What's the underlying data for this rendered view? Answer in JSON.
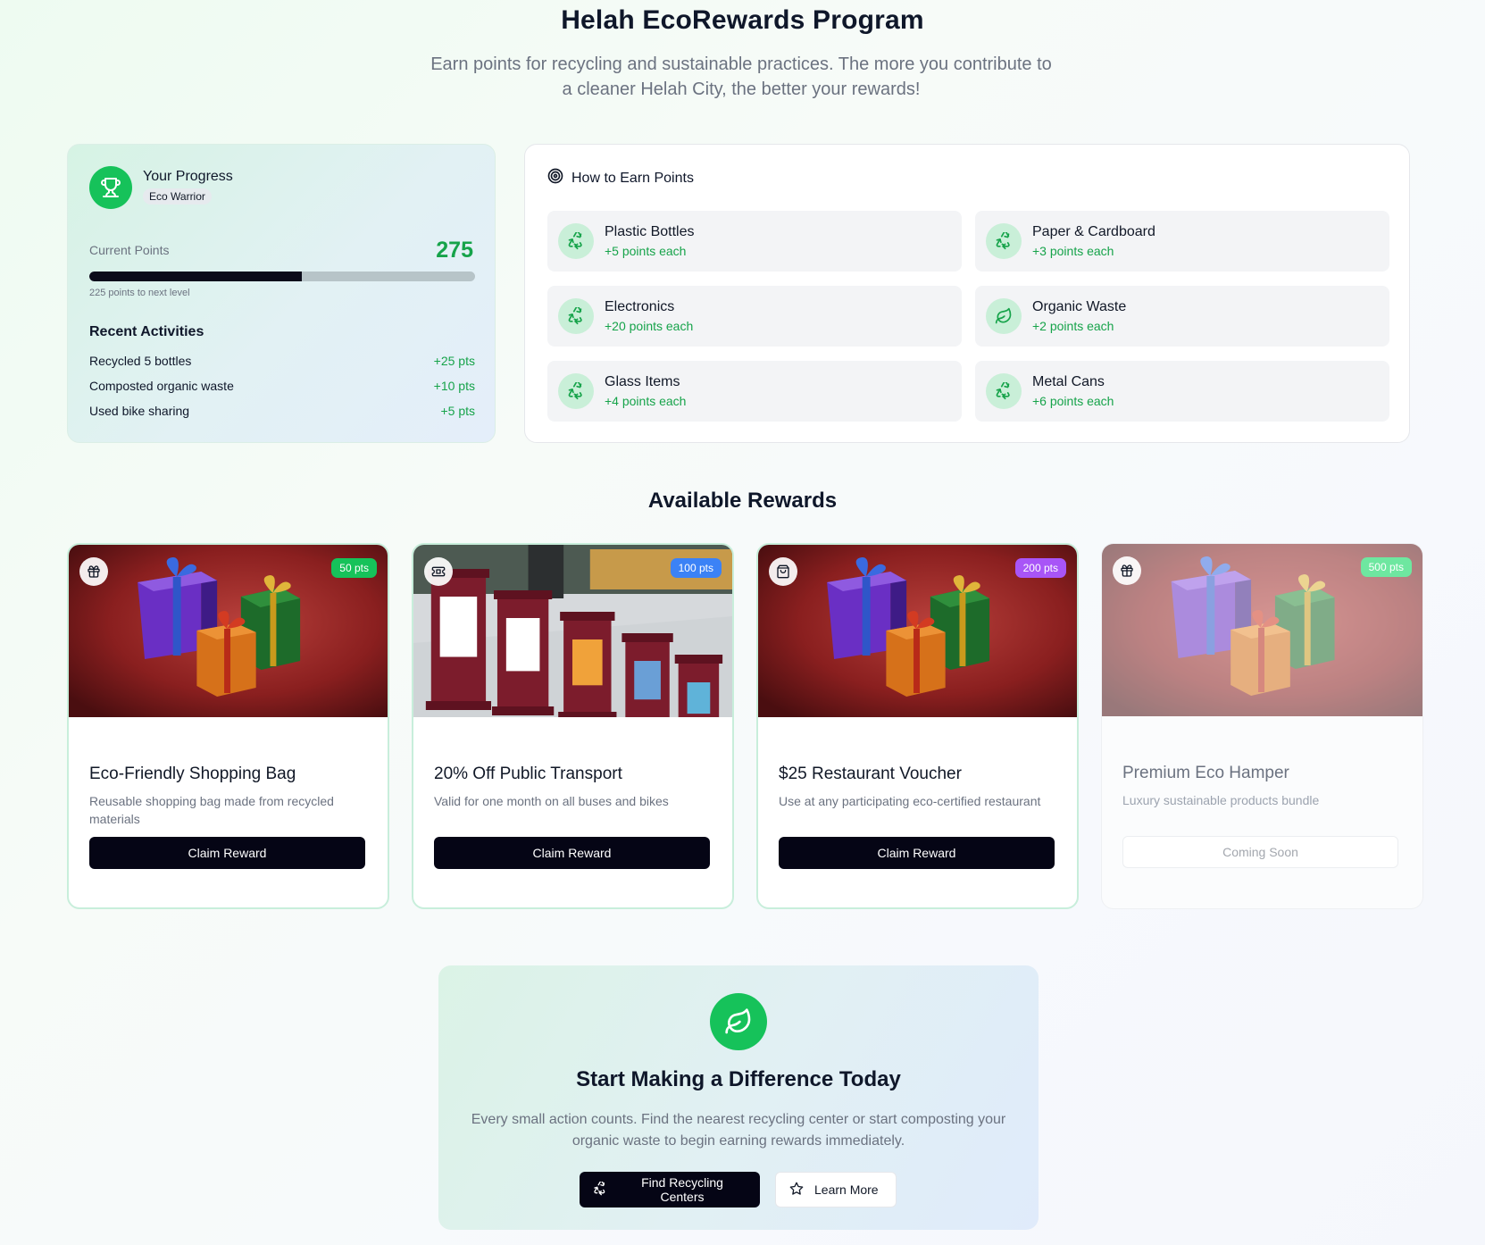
{
  "header": {
    "title": "Helah EcoRewards Program",
    "subtitle": "Earn points for recycling and sustainable practices. The more you contribute to a cleaner Helah City, the better your rewards!"
  },
  "progress": {
    "title": "Your Progress",
    "badge": "Eco Warrior",
    "current_points_label": "Current Points",
    "current_points": "275",
    "progress_fraction": 0.55,
    "next_level_text": "225 points to next level",
    "recent_title": "Recent Activities",
    "activities": [
      {
        "label": "Recycled 5 bottles",
        "points": "+25 pts"
      },
      {
        "label": "Composted organic waste",
        "points": "+10 pts"
      },
      {
        "label": "Used bike sharing",
        "points": "+5 pts"
      }
    ]
  },
  "earn": {
    "title": "How to Earn Points",
    "items": [
      {
        "name": "Plastic Bottles",
        "points": "+5 points each",
        "icon": "recycle-icon"
      },
      {
        "name": "Paper & Cardboard",
        "points": "+3 points each",
        "icon": "recycle-icon"
      },
      {
        "name": "Electronics",
        "points": "+20 points each",
        "icon": "recycle-icon"
      },
      {
        "name": "Organic Waste",
        "points": "+2 points each",
        "icon": "leaf-icon"
      },
      {
        "name": "Glass Items",
        "points": "+4 points each",
        "icon": "recycle-icon"
      },
      {
        "name": "Metal Cans",
        "points": "+6 points each",
        "icon": "recycle-icon"
      }
    ]
  },
  "rewards": {
    "title": "Available Rewards",
    "items": [
      {
        "name": "Eco-Friendly Shopping Bag",
        "description": "Reusable shopping bag made from recycled materials",
        "points": "50 pts",
        "badge_color": "#16c25a",
        "icon": "gift-icon",
        "image": "gifts",
        "button": "Claim Reward",
        "available": true
      },
      {
        "name": "20% Off Public Transport",
        "description": "Valid for one month on all buses and bikes",
        "points": "100 pts",
        "badge_color": "#3b82f6",
        "icon": "ticket-icon",
        "image": "bins",
        "button": "Claim Reward",
        "available": true
      },
      {
        "name": "$25 Restaurant Voucher",
        "description": "Use at any participating eco-certified restaurant",
        "points": "200 pts",
        "badge_color": "#a855f7",
        "icon": "shopping-bag-icon",
        "image": "gifts",
        "button": "Claim Reward",
        "available": true
      },
      {
        "name": "Premium Eco Hamper",
        "description": "Luxury sustainable products bundle",
        "points": "500 pts",
        "badge_color": "#6ee7a0",
        "icon": "gift-icon",
        "image": "gifts",
        "button": "Coming Soon",
        "available": false
      }
    ]
  },
  "cta": {
    "title": "Start Making a Difference Today",
    "text": "Every small action counts. Find the nearest recycling center or start composting your organic waste to begin earning rewards immediately.",
    "primary_button": "Find Recycling Centers",
    "secondary_button": "Learn More"
  },
  "colors": {
    "accent_green": "#16c25a",
    "points_green": "#16a34a",
    "button_dark": "#050515"
  }
}
